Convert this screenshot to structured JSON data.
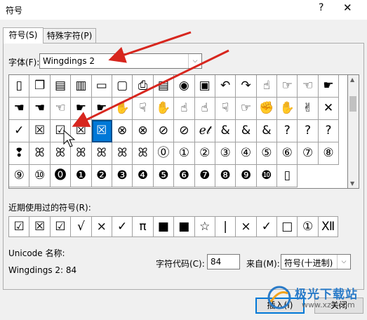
{
  "dialog": {
    "title": "符号",
    "help": "?",
    "close_glyph": "✕"
  },
  "tabs": [
    {
      "label": "符号(S)"
    },
    {
      "label": "特殊字符(P)"
    }
  ],
  "font": {
    "label": "字体(F):",
    "value": "Wingdings 2"
  },
  "grid": {
    "selected_index": 36,
    "cells": [
      "▯",
      "❐",
      "▤",
      "▥",
      "▭",
      "▢",
      "⎙",
      "▤",
      "◉",
      "▣",
      "↶",
      "↷",
      "☝",
      "☞",
      "☜",
      "☛",
      "☚",
      "☚",
      "☜",
      "☛",
      "☛",
      "✋",
      "☟",
      "✋",
      "☝",
      "☝",
      "☟",
      "☞",
      "✊",
      "✋",
      "✌",
      "✕",
      "✓",
      "☒",
      "☑",
      "☒",
      "☒",
      "⊗",
      "⊗",
      "⊘",
      "⊘",
      "ℯ𝓉",
      "&",
      "&",
      "&",
      "?",
      "?",
      "?",
      "❢",
      "ꕤ",
      "ꕤ",
      "ꕤ",
      "ꕤ",
      "ꕤ",
      "ꕤ",
      "⓪",
      "①",
      "②",
      "③",
      "④",
      "⑤",
      "⑥",
      "⑦",
      "⑧",
      "⑨",
      "⑩",
      "⓿",
      "❶",
      "❷",
      "❸",
      "❹",
      "❺",
      "❻",
      "❼",
      "❽",
      "❾",
      "❿",
      "▯"
    ]
  },
  "recent": {
    "label": "近期使用过的符号(R):",
    "symbols": [
      "☑",
      "☒",
      "☑",
      "√",
      "×",
      "✓",
      "π",
      "■",
      "■",
      "☆",
      "|",
      "×",
      "✓",
      "□",
      "①",
      "Ⅻ"
    ]
  },
  "unicode": {
    "name_label": "Unicode 名称:",
    "name_value": "Wingdings 2: 84"
  },
  "char_code": {
    "label": "字符代码(C):",
    "value": "84"
  },
  "from": {
    "label": "来自(M):",
    "value": "符号(十进制)"
  },
  "buttons": {
    "insert": "插入(I)",
    "close": "关闭"
  },
  "watermark": {
    "text": "极光下载站",
    "url": "www.xz7.com"
  },
  "scroll": {
    "up": "▲",
    "down": "▼"
  },
  "dropdown_glyph": "⌵",
  "colors": {
    "selection": "#0078d7",
    "arrow": "#d7261e",
    "accent": "#2a7bc8"
  }
}
